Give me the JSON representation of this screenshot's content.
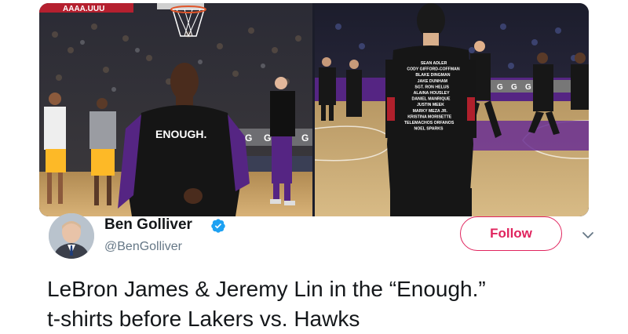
{
  "media": {
    "left_shirt_text": "ENOUGH.",
    "back_names": [
      "SEAN ADLER",
      "CODY GIFFORD-COFFMAN",
      "BLAKE DINGMAN",
      "JAKE DUNHAM",
      "SGT. RON HELUS",
      "ALAINA HOUSLEY",
      "DANIEL MANRIQUE",
      "JUSTIN MEEK",
      "MARKY MEZA JR.",
      "KRISTINA MORISETTE",
      "TELEMACHOS ORFANOS",
      "NOEL SPARKS"
    ],
    "scoreboard_text": "AAAA.UUU",
    "court_letters": [
      "G",
      "G",
      "G"
    ]
  },
  "author": {
    "name": "Ben Golliver",
    "handle": "@BenGolliver",
    "verified": true
  },
  "actions": {
    "follow_label": "Follow"
  },
  "tweet": {
    "text_line1": "LeBron James & Jeremy Lin in the “Enough.”",
    "text_line2": "t-shirts before Lakers vs. Hawks"
  },
  "colors": {
    "accent": "#e0245e",
    "verified": "#1da1f2",
    "handle": "#657786",
    "lakers_purple": "#552583",
    "lakers_gold": "#fdb927"
  }
}
